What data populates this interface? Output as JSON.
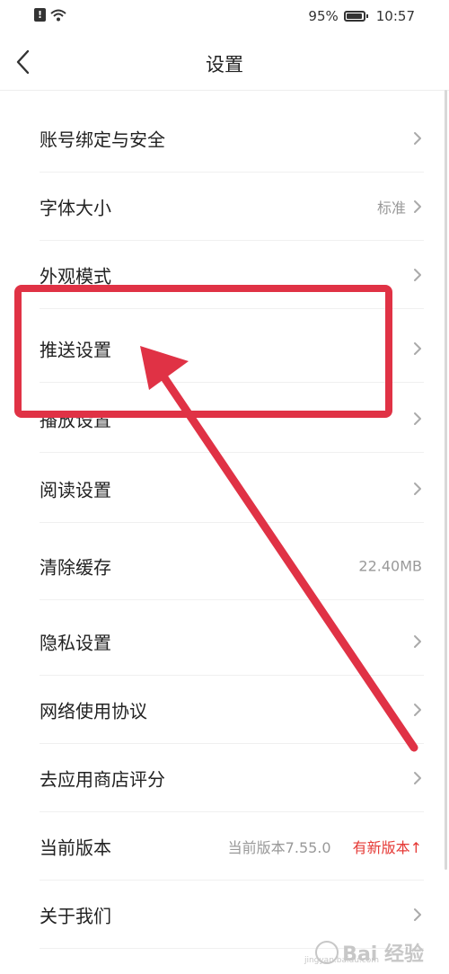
{
  "status_bar": {
    "battery": "95%",
    "time": "10:57",
    "icons": [
      "alert-icon",
      "wifi-icon",
      "battery-icon"
    ]
  },
  "header": {
    "title": "设置",
    "back_icon": "chevron-left-icon"
  },
  "settings": {
    "items": [
      {
        "label": "账号绑定与安全",
        "value": ""
      },
      {
        "label": "字体大小",
        "value": "标准"
      },
      {
        "label": "外观模式",
        "value": ""
      },
      {
        "label": "推送设置",
        "value": ""
      },
      {
        "label": "播放设置",
        "value": ""
      },
      {
        "label": "阅读设置",
        "value": ""
      },
      {
        "label": "清除缓存",
        "value": "22.40MB"
      },
      {
        "label": "隐私设置",
        "value": ""
      },
      {
        "label": "网络使用协议",
        "value": ""
      },
      {
        "label": "去应用商店评分",
        "value": ""
      },
      {
        "label": "当前版本",
        "value": "当前版本7.55.0",
        "update": "有新版本↑"
      },
      {
        "label": "关于我们",
        "value": ""
      }
    ]
  },
  "watermark": {
    "text": "Bai 经验",
    "sub": "jingyan.baidu.com"
  },
  "colors": {
    "annotation": "#e03245",
    "update_text": "#e53935",
    "secondary_text": "#999999"
  }
}
